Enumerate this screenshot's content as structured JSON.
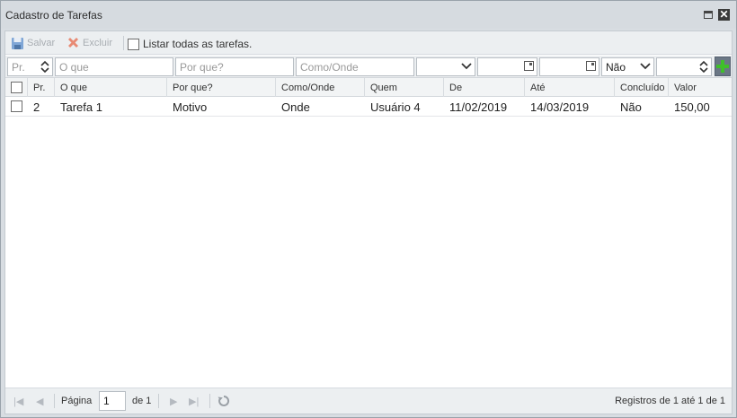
{
  "window": {
    "title": "Cadastro de Tarefas"
  },
  "toolbar": {
    "save_label": "Salvar",
    "delete_label": "Excluir",
    "list_all_label": "Listar todas as tarefas."
  },
  "filters": {
    "pr_placeholder": "Pr.",
    "oque_placeholder": "O que",
    "porque_placeholder": "Por que?",
    "comoonde_placeholder": "Como/Onde",
    "concluido_value": "Não"
  },
  "columns": {
    "pr": "Pr.",
    "oque": "O que",
    "porque": "Por que?",
    "comoonde": "Como/Onde",
    "quem": "Quem",
    "de": "De",
    "ate": "Até",
    "concluido": "Concluído",
    "valor": "Valor"
  },
  "rows": [
    {
      "pr": "2",
      "oque": "Tarefa 1",
      "porque": "Motivo",
      "comoonde": "Onde",
      "quem": "Usuário 4",
      "de": "11/02/2019",
      "ate": "14/03/2019",
      "concluido": "Não",
      "valor": "150,00"
    }
  ],
  "pager": {
    "page_label": "Página",
    "page_value": "1",
    "of_label": "de 1",
    "records_label": "Registros de 1 até 1 de 1"
  },
  "colors": {
    "add_accent": "#3fbf2a",
    "delete_icon": "#e0705a",
    "save_icon": "#5b8fc9"
  }
}
